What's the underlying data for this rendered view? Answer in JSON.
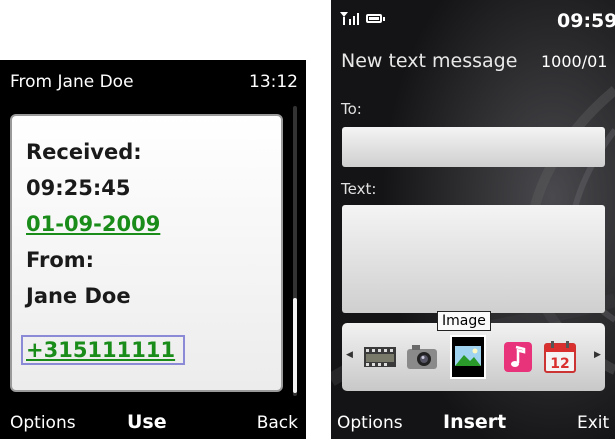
{
  "left_screen": {
    "title": "From Jane Doe",
    "time": "13:12",
    "message": {
      "received_label": "Received:",
      "received_time": "09:25:45",
      "received_date": "01-09-2009",
      "from_label": "From:",
      "from_name": "Jane Doe",
      "from_number": "+315111111"
    },
    "softkeys": {
      "left": "Options",
      "middle": "Use",
      "right": "Back"
    }
  },
  "right_screen": {
    "status": {
      "clock": "09:59"
    },
    "title": "New text message",
    "counter": "1000/01",
    "to_label": "To:",
    "to_value": "",
    "text_label": "Text:",
    "text_value": "",
    "tooltip": "Image",
    "insert_items": [
      "video-icon",
      "camera-icon",
      "image-icon",
      "music-icon",
      "calendar-icon"
    ],
    "calendar_day": "12",
    "selected_item": "image-icon",
    "softkeys": {
      "left": "Options",
      "middle": "Insert",
      "right": "Exit"
    }
  },
  "colors": {
    "link": "#1a8c1a",
    "focus": "#8a8ad6"
  }
}
